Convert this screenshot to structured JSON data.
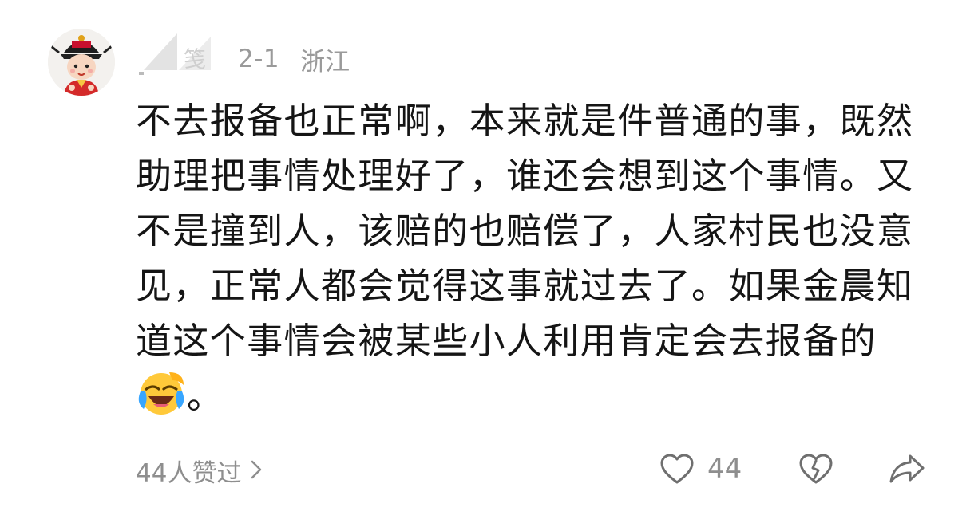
{
  "comment": {
    "user": {
      "name_partial": "笺",
      "avatar": "cartoon-girl-avatar-icon"
    },
    "date": "2-1",
    "location": "浙江",
    "text_before_emoji": "不去报备也正常啊，本来就是件普通的事，既然助理把事情处理好了，谁还会想到这个事情。又不是撞到人，该赔的也赔偿了，人家村民也没意见，正常人都会觉得这事就过去了。如果金晨知道这个事情会被某些小人利用肯定会去报备的",
    "emoji": "laughing-crying-emoji-icon",
    "text_after_emoji": "。",
    "likers_text": "44人赞过",
    "like_count": "44"
  },
  "icons": {
    "likers_chevron": "chevron-right-icon",
    "like": "heart-icon",
    "dislike": "broken-heart-icon",
    "share": "share-arrow-icon"
  },
  "colors": {
    "text": "#151515",
    "muted": "#8e8e8e",
    "meta": "#9a9a9a"
  }
}
